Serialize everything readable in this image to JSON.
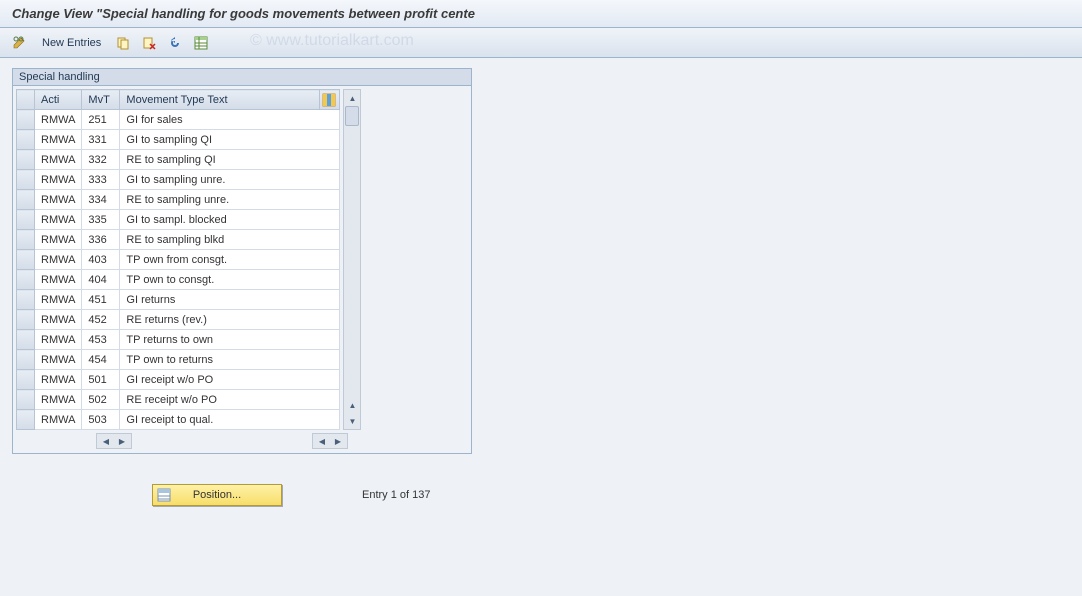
{
  "title": "Change View \"Special handling for goods movements between profit cente",
  "watermark": "© www.tutorialkart.com",
  "toolbar": {
    "new_entries_label": "New Entries",
    "icons": {
      "edit": "edit-icon",
      "copy": "copy-icon",
      "delete": "delete-icon",
      "undo": "undo-icon",
      "select_all": "select-all-icon"
    }
  },
  "group": {
    "title": "Special handling"
  },
  "columns": {
    "acti": "Acti",
    "mvt": "MvT",
    "text": "Movement Type Text"
  },
  "rows": [
    {
      "acti": "RMWA",
      "mvt": "251",
      "text": "GI for sales"
    },
    {
      "acti": "RMWA",
      "mvt": "331",
      "text": "GI to sampling QI"
    },
    {
      "acti": "RMWA",
      "mvt": "332",
      "text": "RE to sampling QI"
    },
    {
      "acti": "RMWA",
      "mvt": "333",
      "text": "GI to sampling unre."
    },
    {
      "acti": "RMWA",
      "mvt": "334",
      "text": "RE to sampling unre."
    },
    {
      "acti": "RMWA",
      "mvt": "335",
      "text": "GI to sampl. blocked"
    },
    {
      "acti": "RMWA",
      "mvt": "336",
      "text": "RE to sampling blkd"
    },
    {
      "acti": "RMWA",
      "mvt": "403",
      "text": "TP own from consgt."
    },
    {
      "acti": "RMWA",
      "mvt": "404",
      "text": "TP own to consgt."
    },
    {
      "acti": "RMWA",
      "mvt": "451",
      "text": "GI returns"
    },
    {
      "acti": "RMWA",
      "mvt": "452",
      "text": "RE returns (rev.)"
    },
    {
      "acti": "RMWA",
      "mvt": "453",
      "text": "TP returns to own"
    },
    {
      "acti": "RMWA",
      "mvt": "454",
      "text": "TP own to returns"
    },
    {
      "acti": "RMWA",
      "mvt": "501",
      "text": "GI receipt w/o PO"
    },
    {
      "acti": "RMWA",
      "mvt": "502",
      "text": "RE receipt w/o PO"
    },
    {
      "acti": "RMWA",
      "mvt": "503",
      "text": "GI receipt to qual."
    }
  ],
  "footer": {
    "position_label": "Position...",
    "entry_text": "Entry 1 of 137"
  }
}
